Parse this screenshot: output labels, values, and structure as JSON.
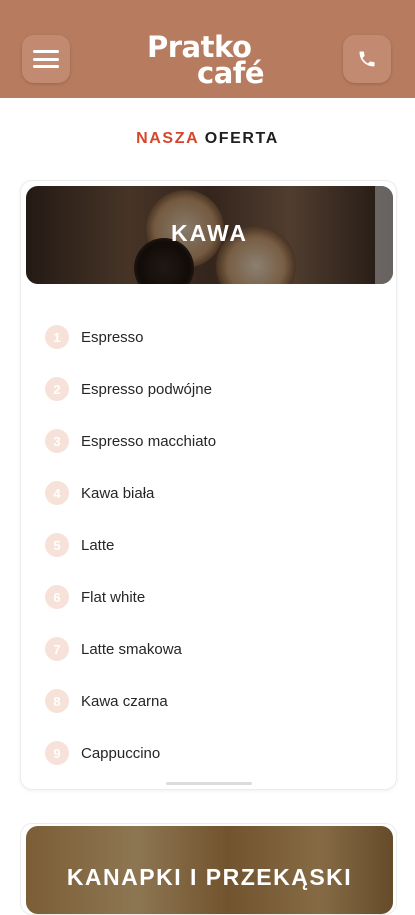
{
  "header": {
    "logo_line1": "Pratko",
    "logo_line2": "café",
    "menu_icon": "hamburger-menu-icon",
    "phone_icon": "phone-icon",
    "background_color": "#b77c5f"
  },
  "section": {
    "title_accent": "NASZA",
    "title_rest": "OFERTA"
  },
  "categories": [
    {
      "title": "KAWA",
      "items": [
        {
          "number": "1",
          "label": "Espresso"
        },
        {
          "number": "2",
          "label": "Espresso podwójne"
        },
        {
          "number": "3",
          "label": "Espresso macchiato"
        },
        {
          "number": "4",
          "label": "Kawa biała"
        },
        {
          "number": "5",
          "label": "Latte"
        },
        {
          "number": "6",
          "label": "Flat white"
        },
        {
          "number": "7",
          "label": "Latte smakowa"
        },
        {
          "number": "8",
          "label": "Kawa czarna"
        },
        {
          "number": "9",
          "label": "Cappuccino"
        }
      ]
    },
    {
      "title": "KANAPKI I PRZEKĄSKI"
    }
  ],
  "colors": {
    "accent": "#d7452a",
    "number_badge": "#f6e2d8"
  }
}
